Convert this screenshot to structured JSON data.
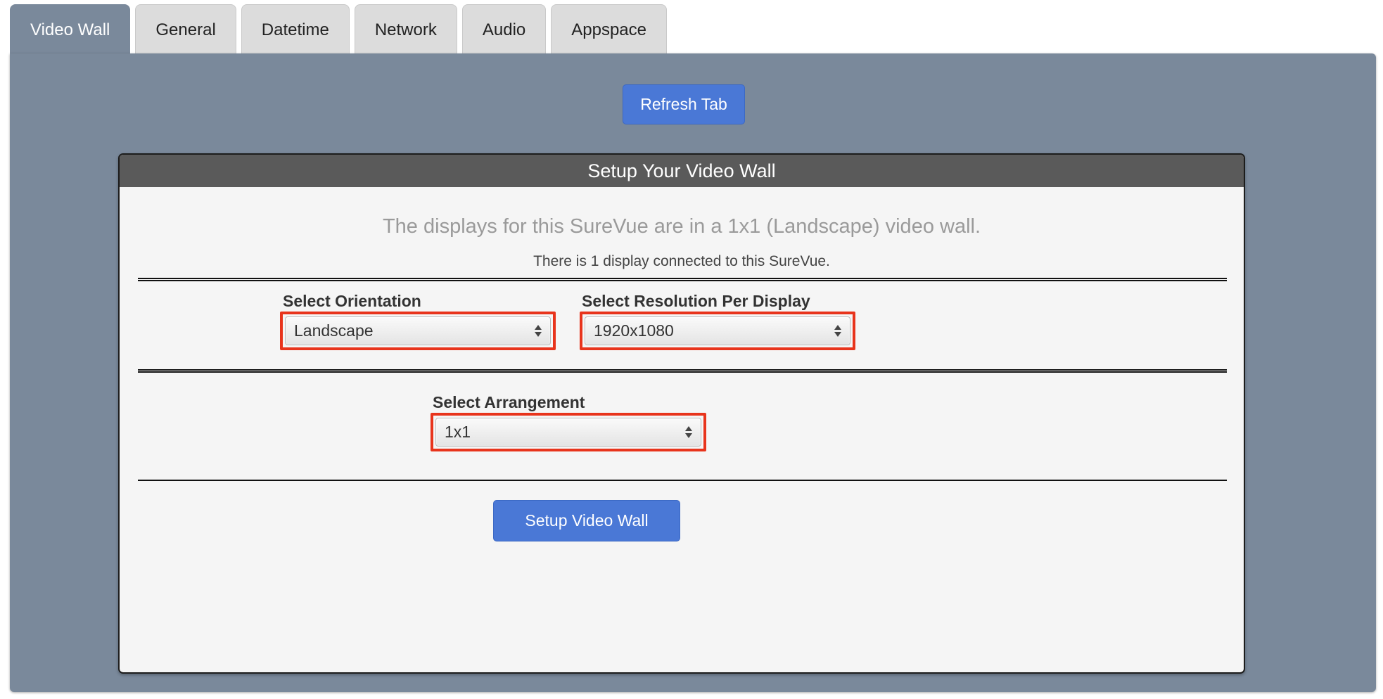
{
  "tabs": [
    {
      "label": "Video Wall",
      "active": true
    },
    {
      "label": "General",
      "active": false
    },
    {
      "label": "Datetime",
      "active": false
    },
    {
      "label": "Network",
      "active": false
    },
    {
      "label": "Audio",
      "active": false
    },
    {
      "label": "Appspace",
      "active": false
    }
  ],
  "refresh_button": "Refresh Tab",
  "card": {
    "title": "Setup Your Video Wall",
    "summary": "The displays for this SureVue are in a 1x1 (Landscape) video wall.",
    "count": "There is 1 display connected to this SureVue."
  },
  "orientation": {
    "label": "Select Orientation",
    "value": "Landscape"
  },
  "resolution": {
    "label": "Select Resolution Per Display",
    "value": "1920x1080"
  },
  "arrangement": {
    "label": "Select Arrangement",
    "value": "1x1"
  },
  "setup_button": "Setup Video Wall",
  "colors": {
    "panel": "#7a899b",
    "primary_button": "#4a78d6",
    "highlight": "#e8341c",
    "card_header": "#5a5a5a"
  }
}
